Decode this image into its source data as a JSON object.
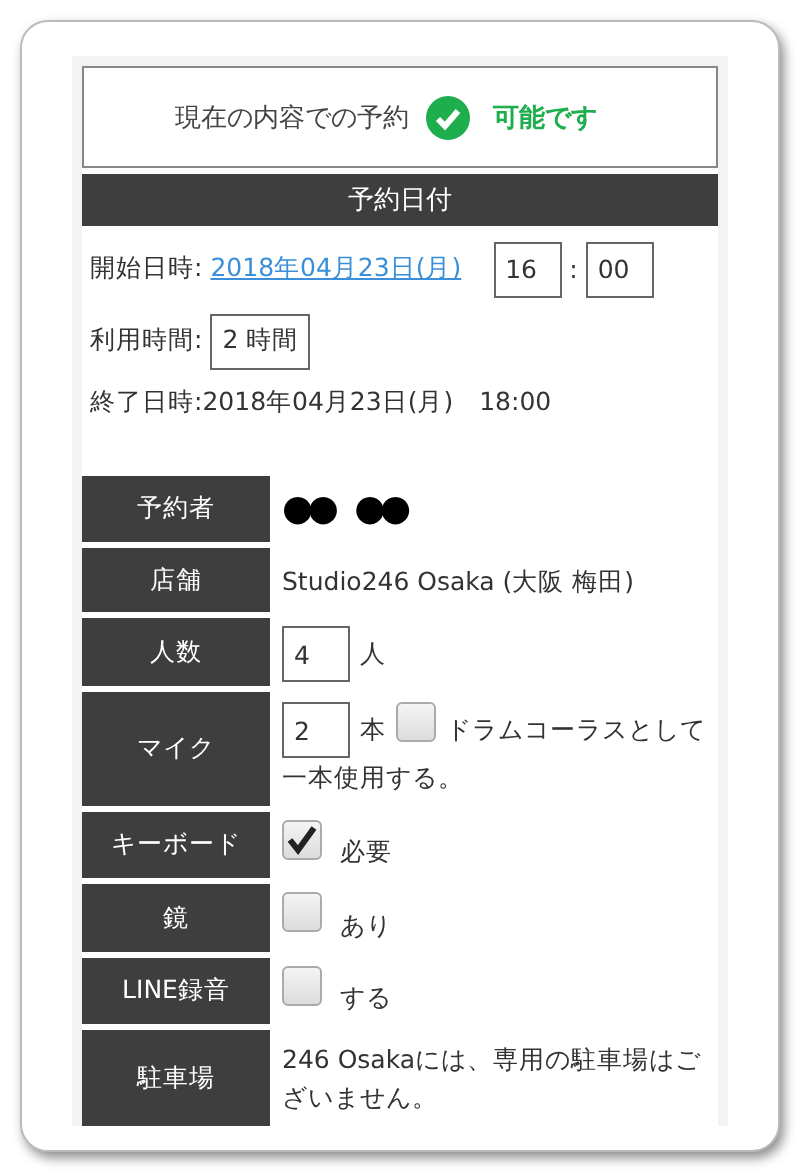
{
  "availability": {
    "label": "現在の内容での予約",
    "available": true,
    "status": "可能です"
  },
  "date_section": {
    "title": "予約日付",
    "start": {
      "label": "開始日時:",
      "date": "2018年04月23日(月)",
      "hour": "16",
      "separator": ":",
      "minute": "00"
    },
    "duration": {
      "label": "利用時間:",
      "value": "2 時間"
    },
    "end": {
      "label": "終了日時:",
      "value": "2018年04月23日(月)　18:00"
    }
  },
  "rows": [
    {
      "kind": "masked",
      "label": "予約者",
      "value": "●● ●●"
    },
    {
      "kind": "text",
      "label": "店舗",
      "value": "Studio246 Osaka (大阪 梅田)"
    },
    {
      "kind": "number",
      "label": "人数",
      "value": "4",
      "unit": "人"
    },
    {
      "kind": "mic",
      "label": "マイク",
      "value": "2",
      "unit": "本",
      "checked": false,
      "option_lines": [
        "ドラムコーラスとして",
        "一本使用する。"
      ]
    },
    {
      "kind": "checkbox",
      "label": "キーボード",
      "checked": true,
      "option": "必要"
    },
    {
      "kind": "checkbox",
      "label": "鏡",
      "checked": false,
      "option": "あり"
    },
    {
      "kind": "checkbox",
      "label": "LINE録音",
      "checked": false,
      "option": "する"
    },
    {
      "kind": "text",
      "label": "駐車場",
      "value": "246 Osakaには、専用の駐車場はございません。"
    }
  ]
}
